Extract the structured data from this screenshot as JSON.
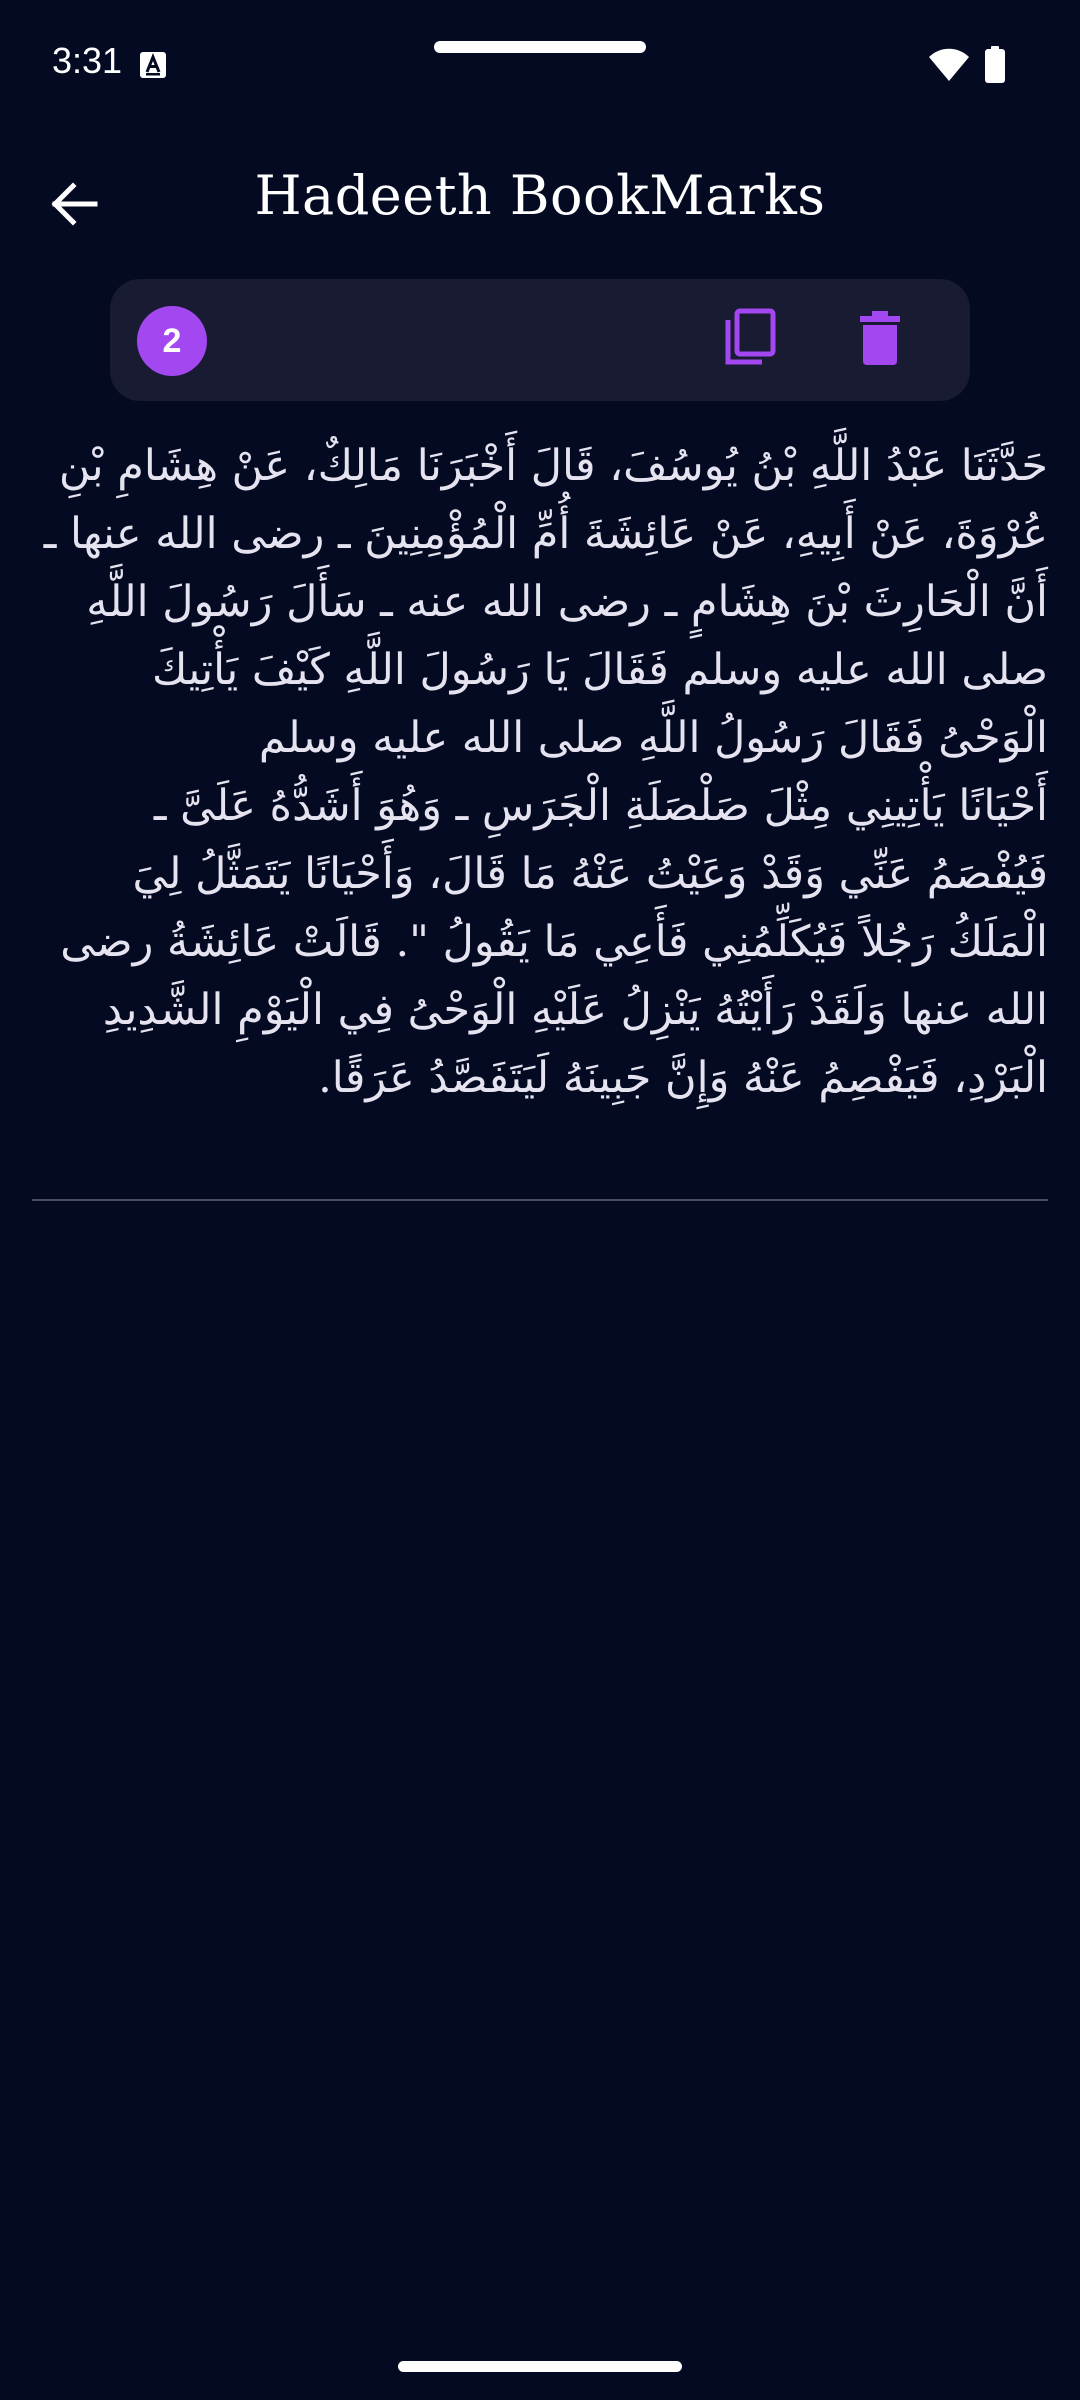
{
  "status_bar": {
    "time": "3:31",
    "icons": [
      "text-a-icon",
      "wifi-icon",
      "battery-icon"
    ]
  },
  "header": {
    "title": "Hadeeth BookMarks",
    "back_icon": "arrow-left-icon"
  },
  "action_card": {
    "count": "2",
    "copy_icon": "copy-icon",
    "delete_icon": "trash-icon"
  },
  "bookmark": {
    "text": "حَدَّثَنَا عَبْدُ اللَّهِ بْنُ يُوسُفَ، قَالَ أَخْبَرَنَا مَالِكٌ، عَنْ هِشَامِ بْنِ عُرْوَةَ، عَنْ أَبِيهِ، عَنْ عَائِشَةَ أُمِّ الْمُؤْمِنِينَ ـ رضى الله عنها ـ أَنَّ الْحَارِثَ بْنَ هِشَامٍ ـ رضى الله عنه ـ سَأَلَ رَسُولَ اللَّهِ صلى الله عليه وسلم فَقَالَ يَا رَسُولَ اللَّهِ كَيْفَ يَأْتِيكَ الْوَحْىُ فَقَالَ رَسُولُ اللَّهِ صلى الله عليه وسلم\n أَحْيَانًا يَأْتِينِي مِثْلَ صَلْصَلَةِ الْجَرَسِ ـ وَهُوَ أَشَدُّهُ عَلَىَّ ـ فَيُفْصَمُ عَنِّي وَقَدْ وَعَيْتُ عَنْهُ مَا قَالَ، وَأَحْيَانًا يَتَمَثَّلُ لِيَ الْمَلَكُ رَجُلاً فَيُكَلِّمُنِي فَأَعِي مَا يَقُولُ \". قَالَتْ عَائِشَةُ رضى الله عنها وَلَقَدْ رَأَيْتُهُ يَنْزِلُ عَلَيْهِ الْوَحْىُ فِي الْيَوْمِ الشَّدِيدِ الْبَرْدِ، فَيَفْصِمُ عَنْهُ وَإِنَّ جَبِينَهُ لَيَتَفَصَّدُ عَرَقًا."
  },
  "colors": {
    "background": "#040a22",
    "card": "#181b31",
    "accent": "#a347f1",
    "text": "#e6e3f0",
    "divider": "#4a4d63"
  }
}
